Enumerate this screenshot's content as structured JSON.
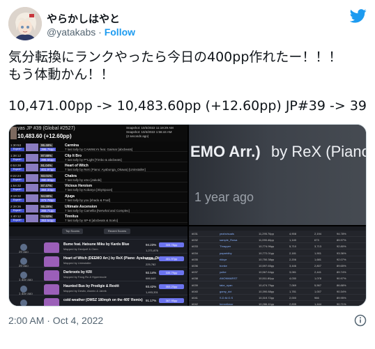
{
  "author": {
    "display_name": "やらかしはやと",
    "handle": "@yatakabs",
    "separator": "·",
    "follow_label": "Follow"
  },
  "tweet": {
    "line1": "気分転換にランクやったら今日の400pp作れたー！！！",
    "line2": "もう体動かん！！",
    "line3": "10,471.00pp -> 10,483.60pp (+12.60pp) JP#39 -> 39"
  },
  "media": {
    "img1": {
      "player": "yas   JP #39 (Global #2527)",
      "pp": "10,483.60 (+12.60pp)",
      "meta_lines": [
        "Snapshot: 10/3/2022 11:19:29 AM",
        "Snapshot: 10/4/2022 1:56:44 AM",
        "(2 seconds ago)"
      ],
      "rows": [
        {
          "time": "1:30:53",
          "tag": "Expert+",
          "acc": "95.48%",
          "pp": "395.76pp",
          "title": "Carmina",
          "sub": "7 last tally by CAWWLYs feat. Gaimar [abcbeats]"
        },
        {
          "time": "1:38:12",
          "tag": "Expert+",
          "acc": "97.88%",
          "pp": "395.65pp",
          "title": "Clip It Bro",
          "sub": "7 last tally by P*Light [Timbo & abcbeats]"
        },
        {
          "time": "0:53:38",
          "tag": "Expert+",
          "acc": "91.04%",
          "pp": "401.97pp",
          "title": "Heart of Witch",
          "sub": "7 last tally by ReX (Piano: Ayabunga_Okawa) [Uninstaller]"
        },
        {
          "time": "0:22:24",
          "tag": "Expert+",
          "acc": "93.01%",
          "pp": "390.99pp",
          "title": "Chakra",
          "sub": "7 last tally by xmo [Jakobi]"
        },
        {
          "time": "1:54:32",
          "tag": "Expert+",
          "acc": "97.47%",
          "pp": "384.33pp",
          "title": "Vicious Heroism",
          "sub": "7 last tally by Kobaryo [SkySpoon]"
        },
        {
          "time": "3:19:32",
          "tag": "Expert+",
          "acc": "94.88%",
          "pp": "372.78pp",
          "title": "Ajuga",
          "sub": "7 last tally by you [shado & Fnaf]"
        },
        {
          "time": "2:39:36",
          "tag": "Expert+",
          "acc": "95.29%",
          "pp": "365.71pp",
          "title": "Ultimate Ascension",
          "sub": "7 last tally by Camellia [Nerwhal and Complex]"
        },
        {
          "time": "1:40:12",
          "tag": "Expert+",
          "acc": "74.92%",
          "pp": "353.54pp",
          "title": "Tinnitus",
          "sub": "7 last tally by SP-8 [abcbeats & Scelo]"
        }
      ]
    },
    "img2": {
      "title": "EMO Arr.)",
      "by": "by ReX (Piano:",
      "ago": "1 year ago"
    },
    "img3": {
      "buttons": [
        "Top Scores",
        "Recent Scores"
      ],
      "rows": [
        {
          "time": "20 ago",
          "title": "Bume feat. Hatsune Miku by Kards Blue",
          "sub": "Mapped by Decipulf & Clem",
          "acc": "94.23%",
          "pp": "305.78pp",
          "score": "1,271,876"
        },
        {
          "time": "20 ago",
          "title": "Heart of Witch (DEEMO Arr.) by ReX (Piano: Ayabunga_Okawa)",
          "sub": "Mapped by Uninstaller",
          "acc": "91.04%",
          "pp": "401.97pp",
          "score": "225,782"
        },
        {
          "time": "1 day ago",
          "title": "Darkroots by KRI",
          "sub": "Mapped by Fang Ro & Hypermode",
          "acc": "92.14%",
          "pp": "335.79pp",
          "score": "686,649"
        },
        {
          "time": "1 day ago",
          "title": "Haunted Bus by Prodigie & Rexitt",
          "sub": "Mapped by Destix, Atomix & Jabrik",
          "acc": "93.42%",
          "pp": "353.23pp",
          "score": "1,493,331"
        },
        {
          "time": "",
          "title": "cold weather (OMSZ 180mph on the 405' Remix)",
          "sub": "",
          "acc": "91.17%",
          "pp": "367.95pp",
          "score": ""
        }
      ]
    },
    "img4": {
      "rows": [
        {
          "rank": "#031",
          "name": "yeahvisuals",
          "pp": "11,295.76pp",
          "c1": "4,908",
          "c2": "2,194",
          "c3": "94.78%"
        },
        {
          "rank": "#032",
          "name": "sample_Rowa",
          "pp": "11,090.46pp",
          "c1": "1,140",
          "c2": "673",
          "c3": "89.97%"
        },
        {
          "rank": "#033",
          "name": "Thrapper",
          "pp": "10,774.96pp",
          "c1": "5,710",
          "c2": "3,713",
          "c3": "92.80%"
        },
        {
          "rank": "#034",
          "name": "paparidby",
          "pp": "10,772.01pp",
          "c1": "2,181",
          "c2": "1,901",
          "c3": "93.36%"
        },
        {
          "rank": "#035",
          "name": "rikkye",
          "pp": "10,750.38pp",
          "c1": "2,206",
          "c2": "1,681",
          "c3": "92.07%"
        },
        {
          "rank": "#036",
          "name": "bonke",
          "pp": "10,597.65pp",
          "c1": "3,446",
          "c2": "2,807",
          "c3": "89.65%"
        },
        {
          "rank": "#037",
          "name": "yuibe",
          "pp": "10,567.64pp",
          "c1": "3,081",
          "c2": "2,441",
          "c3": "89.74%"
        },
        {
          "rank": "#038",
          "name": "ANONMARST",
          "pp": "10,511.80pp",
          "c1": "4,030",
          "c2": "1,078",
          "c3": "90.97%"
        },
        {
          "rank": "#039",
          "name": "take_nyan",
          "pp": "10,474.79pp",
          "c1": "7,069",
          "c2": "5,567",
          "c3": "86.88%"
        },
        {
          "rank": "#040",
          "name": "gamy_dct",
          "pp": "10,390.88pp",
          "c1": "1,781",
          "c2": "1,007",
          "c3": "90.34%"
        },
        {
          "rank": "#041",
          "name": "S.D.M.O.S",
          "pp": "10,319.72pp",
          "c1": "2,000",
          "c2": "966",
          "c3": "89.95%"
        },
        {
          "rank": "#042",
          "name": "hennrikwor",
          "pp": "10,286.41pp",
          "c1": "2,835",
          "c2": "1,444",
          "c3": "90.71%"
        }
      ]
    }
  },
  "footer": {
    "timestamp": "2:00 AM · Oct 4, 2022"
  },
  "colors": {
    "twitter_blue": "#1d9bf0",
    "muted": "#536471",
    "text": "#0f1419"
  },
  "icons": {
    "brand": "twitter-bird-icon",
    "info": "info-icon"
  }
}
